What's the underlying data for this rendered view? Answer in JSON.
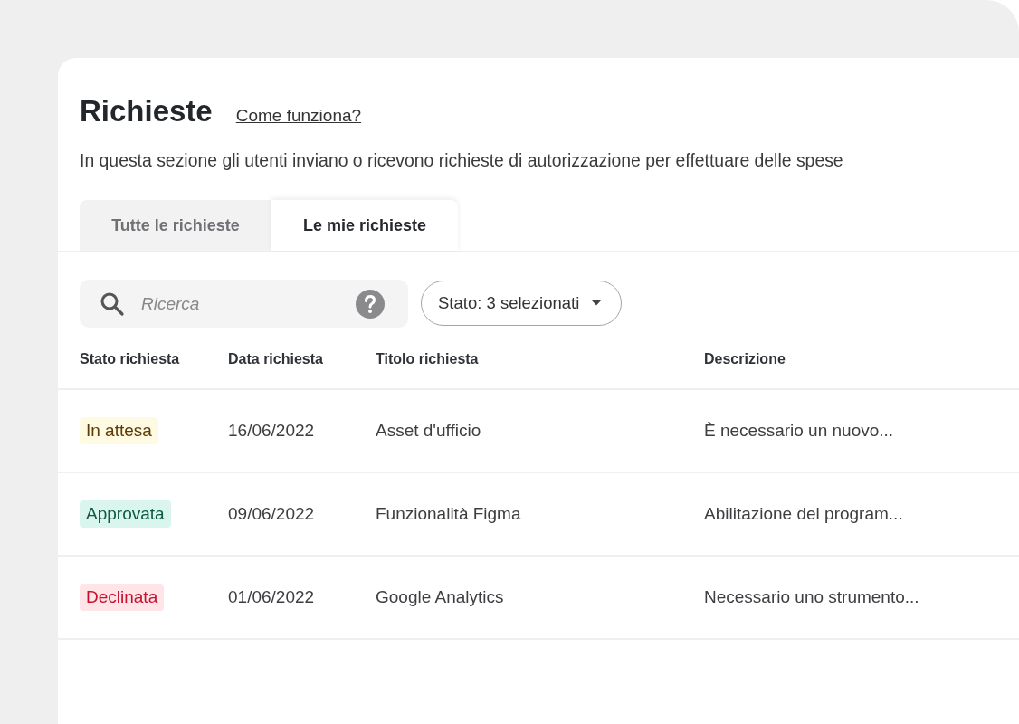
{
  "header": {
    "title": "Richieste",
    "help_link": "Come funziona?",
    "description": "In questa sezione gli utenti inviano o ricevono richieste di autorizzazione per effettuare delle spese"
  },
  "tabs": [
    {
      "label": "Tutte le richieste",
      "selected": false
    },
    {
      "label": "Le mie richieste",
      "selected": true
    }
  ],
  "search": {
    "placeholder": "Ricerca"
  },
  "filter": {
    "label": "Stato: 3 selezionati"
  },
  "table": {
    "columns": [
      "Stato richiesta",
      "Data richiesta",
      "Titolo richiesta",
      "Descrizione"
    ],
    "rows": [
      {
        "status": "In attesa",
        "kind": "pending",
        "date": "16/06/2022",
        "title": "Asset d'ufficio",
        "description": "È necessario un nuovo..."
      },
      {
        "status": "Approvata",
        "kind": "approved",
        "date": "09/06/2022",
        "title": "Funzionalità Figma",
        "description": "Abilitazione del program..."
      },
      {
        "status": "Declinata",
        "kind": "declined",
        "date": "01/06/2022",
        "title": "Google Analytics",
        "description": "Necessario uno strumento..."
      }
    ]
  }
}
